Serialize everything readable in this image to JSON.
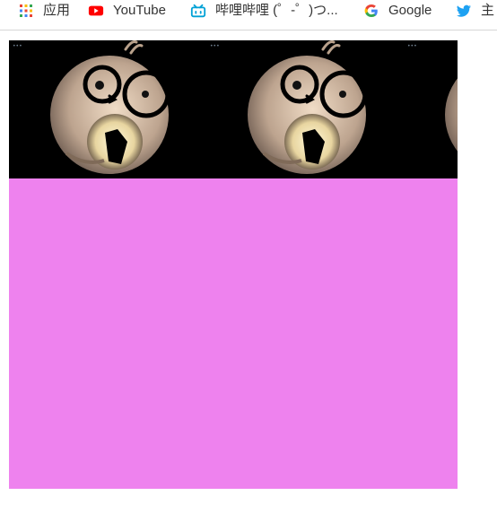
{
  "bookmarks": [
    {
      "label": "应用",
      "icon": "apps-grid-icon"
    },
    {
      "label": "YouTube",
      "icon": "youtube-icon"
    },
    {
      "label": "哔哩哔哩 (゜-゜)つ...",
      "icon": "bilibili-icon"
    },
    {
      "label": "Google",
      "icon": "google-icon"
    },
    {
      "label": "主",
      "icon": "twitter-icon"
    }
  ],
  "colors": {
    "page_background": "#ffffff",
    "pink_area": "#ee82ee",
    "image_strip_background": "#000000",
    "bookmark_text": "#333333"
  },
  "content": {
    "image_tiles": 3,
    "image_subject": "cartoon creature with round glasses holding a glowing phone"
  }
}
